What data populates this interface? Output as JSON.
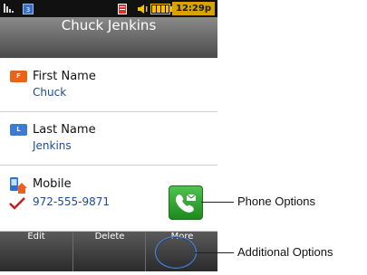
{
  "status_bar": {
    "time": "12:29p",
    "icons": [
      "signal-icon",
      "network-3g-icon",
      "message-icon",
      "volume-icon",
      "battery-icon"
    ]
  },
  "header": {
    "title": "Chuck Jenkins"
  },
  "fields": [
    {
      "icon": "first-name-icon",
      "icon_text": "F",
      "label": "First Name",
      "value": "Chuck"
    },
    {
      "icon": "last-name-icon",
      "icon_text": "L",
      "label": "Last Name",
      "value": "Jenkins"
    },
    {
      "icon": "mobile-phone-icon",
      "label": "Mobile",
      "value": "972-555-9871"
    }
  ],
  "softkeys": [
    {
      "label": "Edit"
    },
    {
      "label": "Delete"
    },
    {
      "label": "More"
    }
  ],
  "callouts": {
    "phone_options": "Phone Options",
    "additional_options": "Additional Options"
  },
  "colors": {
    "value_text": "#1b4b9a",
    "call_button": "#2aa52a",
    "status_time_bg": "#d8a300",
    "badge_orange": "#e8641c",
    "badge_blue": "#3a7bd5"
  }
}
